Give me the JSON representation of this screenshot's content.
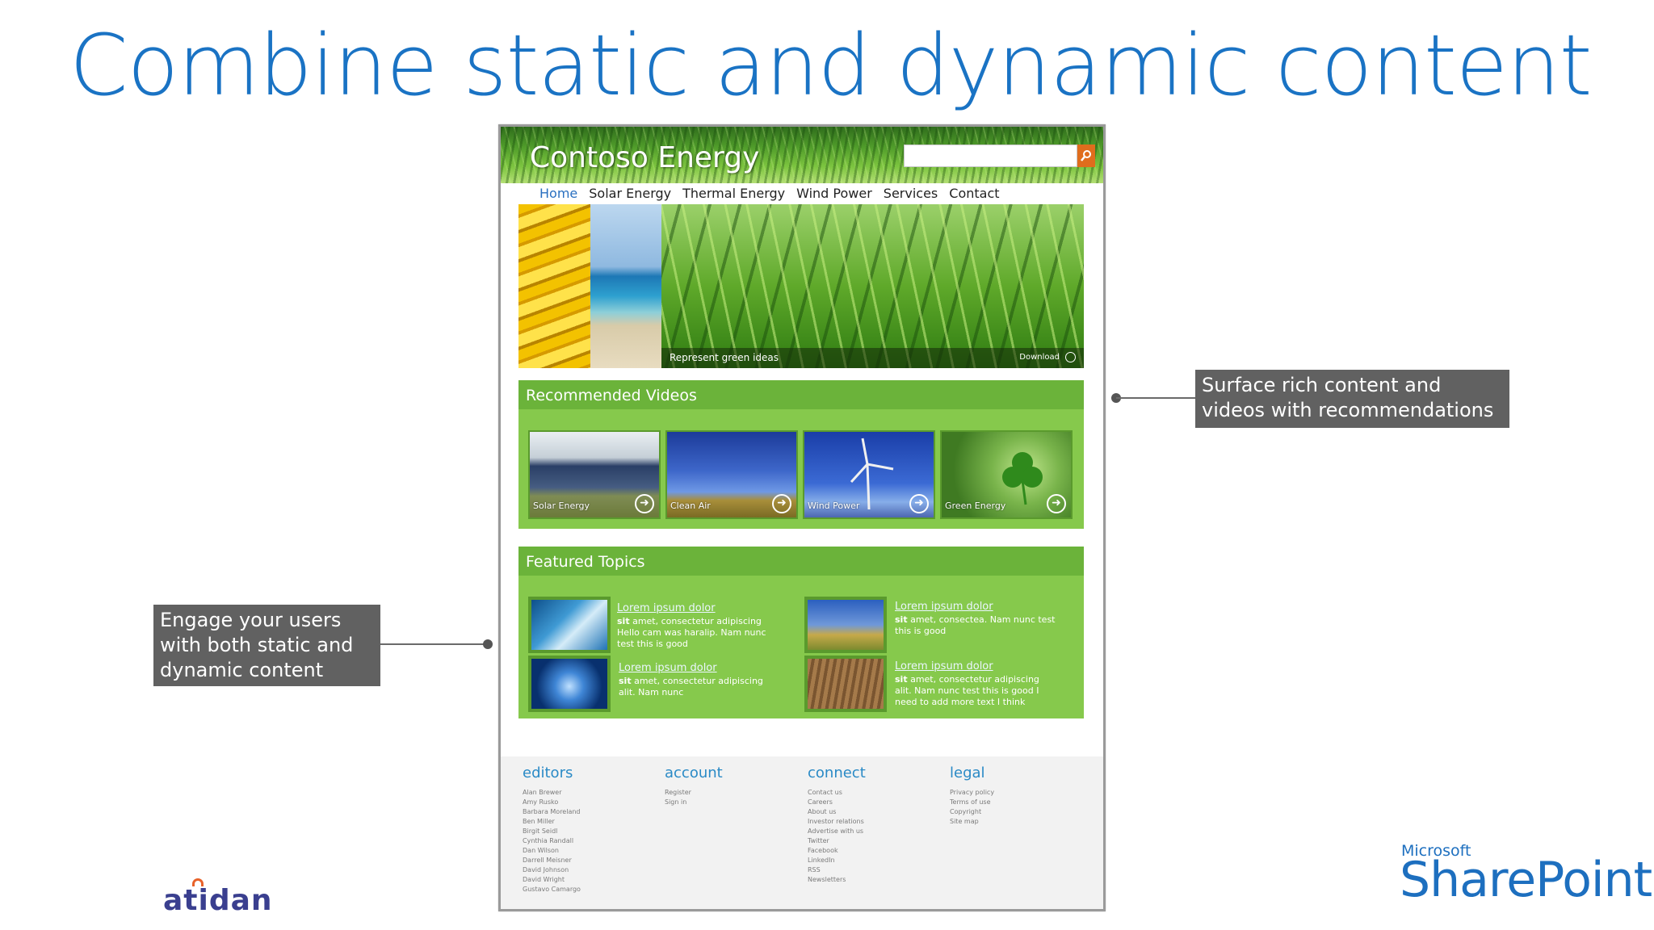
{
  "slide": {
    "title": "Combine static and dynamic content"
  },
  "site": {
    "logo": "Contoso Energy",
    "search": {
      "placeholder": ""
    },
    "nav": [
      "Home",
      "Solar Energy",
      "Thermal Energy",
      "Wind Power",
      "Services",
      "Contact"
    ],
    "active_nav": "Home",
    "hero": {
      "caption": "Represent green ideas",
      "download_label": "Download"
    },
    "videos": {
      "title": "Recommended  Videos",
      "items": [
        {
          "label": "Solar  Energy"
        },
        {
          "label": "Clean  Air"
        },
        {
          "label": "Wind  Power"
        },
        {
          "label": "Green Energy"
        }
      ]
    },
    "topics": {
      "title": "Featured  Topics",
      "items": [
        {
          "link": "Lorem ipsum dolor",
          "bold": "sit",
          "text": "amet, consectetur adipiscing Hello cam was haralip. Nam nunc test this is good"
        },
        {
          "link": "Lorem ipsum dolor",
          "bold": "sit",
          "text": "amet, consectea. Nam nunc test this is good"
        },
        {
          "link": "Lorem ipsum dolor",
          "bold": "sit",
          "text": "amet, consectetur adipiscing alit. Nam nunc"
        },
        {
          "link": "Lorem ipsum dolor",
          "bold": "sit",
          "text": "amet, consectetur adipiscing alit. Nam nunc test this is good I need to add more text I think"
        }
      ]
    },
    "footer": {
      "columns": [
        {
          "heading": "editors",
          "items": [
            "Alan Brewer",
            "Amy Rusko",
            "Barbara Moreland",
            "Ben Miller",
            "Birgit Seidl",
            "Cynthia Randall",
            "Dan Wilson",
            "Darrell Meisner",
            "David Johnson",
            "David Wright",
            "Gustavo Camargo"
          ]
        },
        {
          "heading": "account",
          "items": [
            "Register",
            "Sign in"
          ]
        },
        {
          "heading": "connect",
          "items": [
            "Contact us",
            "Careers",
            "About us",
            "Investor relations",
            "Advertise with us",
            "Twitter",
            "Facebook",
            "LinkedIn",
            "RSS",
            "Newsletters"
          ]
        },
        {
          "heading": "legal",
          "items": [
            "Privacy policy",
            "Terms of use",
            "Copyright",
            "Site map"
          ]
        }
      ]
    }
  },
  "callouts": {
    "right": "Surface rich content and videos with recommendations",
    "left": "Engage your users with both static and dynamic content"
  },
  "logos": {
    "atidan": "atidan",
    "microsoft": "Microsoft",
    "sharepoint": "SharePoint"
  },
  "colors": {
    "title_blue": "#1a73c4",
    "panel_green": "#86c94c",
    "panel_head_green": "#6bb33a",
    "callout_gray": "#616161",
    "search_orange": "#e06d1d"
  }
}
